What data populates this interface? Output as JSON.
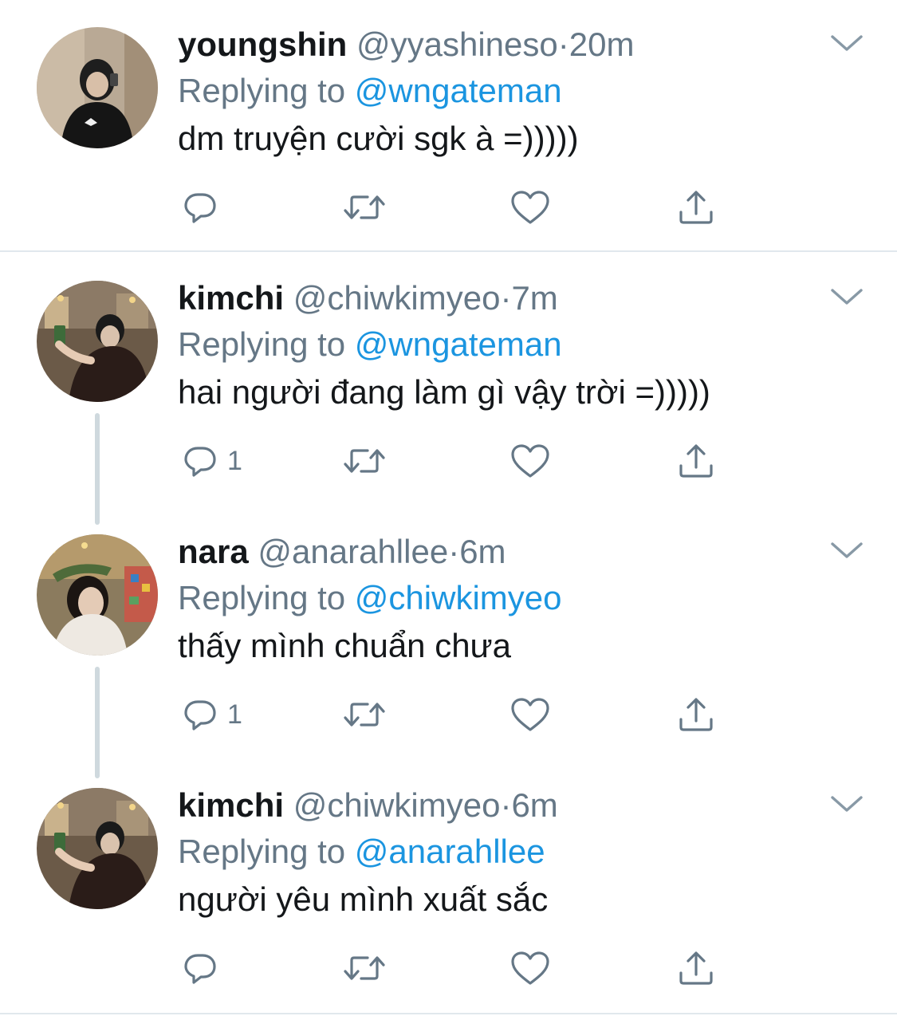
{
  "tweets": [
    {
      "name": "youngshin",
      "handle": "@yyashineso",
      "dot": "·",
      "time": "20m",
      "replying_label": "Replying to",
      "replying_to": "@wngateman",
      "text": "dm truyện cười sgk à =)))))",
      "reply_count": ""
    },
    {
      "name": "kimchi",
      "handle": "@chiwkimyeo",
      "dot": "·",
      "time": "7m",
      "replying_label": "Replying to",
      "replying_to": "@wngateman",
      "text": "hai người đang làm gì vậy trời =)))))",
      "reply_count": "1"
    },
    {
      "name": "nara",
      "handle": "@anarahllee",
      "dot": "·",
      "time": "6m",
      "replying_label": "Replying to",
      "replying_to": "@chiwkimyeo",
      "text": "thấy mình chuẩn chưa",
      "reply_count": "1"
    },
    {
      "name": "kimchi",
      "handle": "@chiwkimyeo",
      "dot": "·",
      "time": "6m",
      "replying_label": "Replying to",
      "replying_to": "@anarahllee",
      "text": "người yêu mình xuất sắc",
      "reply_count": ""
    }
  ],
  "icons": {
    "reply": "speech-bubble-icon",
    "retweet": "retweet-icon",
    "like": "heart-icon",
    "share": "share-upload-icon",
    "more": "chevron-down-icon"
  },
  "colors": {
    "link": "#1b95e0",
    "secondary": "#657786",
    "primary": "#14171a",
    "divider": "#e1e8ed",
    "thread": "#cfd9de"
  }
}
